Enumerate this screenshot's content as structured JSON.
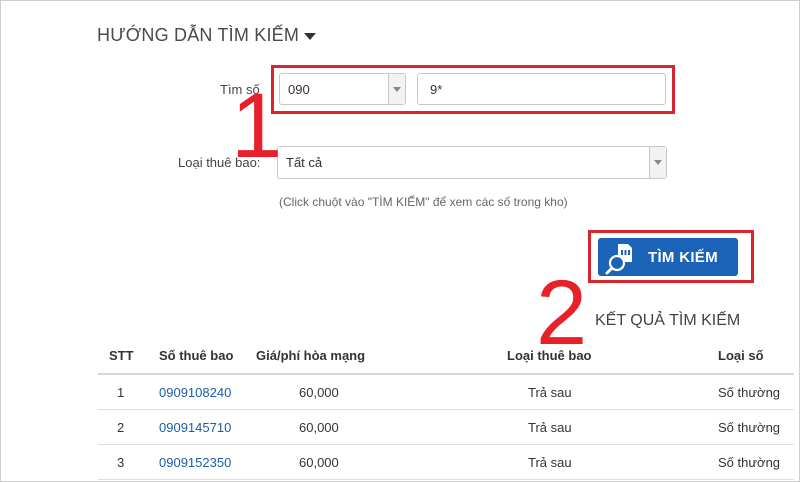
{
  "guide": {
    "title": "HƯỚNG DẪN TÌM KIẾM"
  },
  "form": {
    "search_label": "Tìm số",
    "prefix_value": "090",
    "number_value": "9*",
    "type_label": "Loại thuê bao:",
    "type_value": "Tất cả",
    "hint": "(Click chuột vào \"TÌM KIẾM\" để xem các số trong kho)",
    "search_button": "TÌM KIẾM"
  },
  "annotations": {
    "step1": "1",
    "step2": "2",
    "accent": "#e8202a"
  },
  "results": {
    "title": "KẾT QUẢ TÌM KIẾM",
    "columns": [
      "STT",
      "Số thuê bao",
      "Giá/phí hòa mạng",
      "Loại thuê bao",
      "Loại số"
    ],
    "rows": [
      {
        "stt": "1",
        "number": "0909108240",
        "fee": "60,000",
        "sub_type": "Trả sau",
        "num_type": "Số thường"
      },
      {
        "stt": "2",
        "number": "0909145710",
        "fee": "60,000",
        "sub_type": "Trả sau",
        "num_type": "Số thường"
      },
      {
        "stt": "3",
        "number": "0909152350",
        "fee": "60,000",
        "sub_type": "Trả sau",
        "num_type": "Số thường"
      }
    ]
  },
  "colors": {
    "button": "#1a63b6",
    "link": "#1a5ea7",
    "highlight": "#d9252e"
  }
}
